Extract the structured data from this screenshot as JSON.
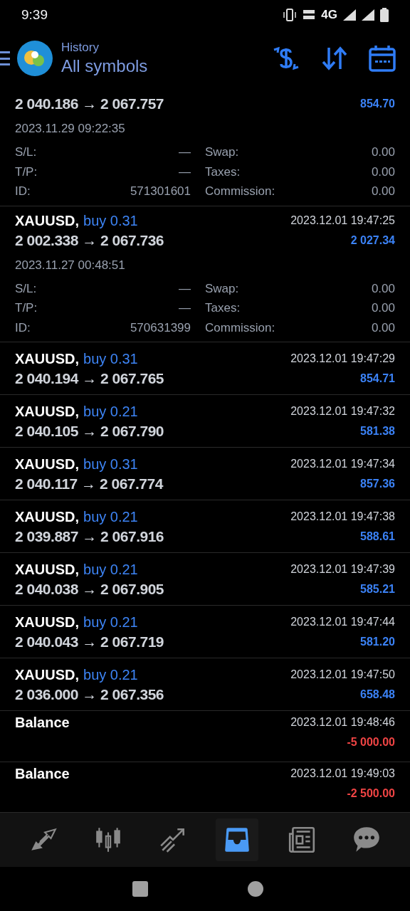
{
  "status_bar": {
    "time": "9:39",
    "network": "4G"
  },
  "header": {
    "subtitle": "History",
    "title": "All symbols"
  },
  "deals": [
    {
      "kind": "trade",
      "prices": "2 040.186 → 2 067.757",
      "profit": "854.70",
      "color": "#3b82f6",
      "open_time": "2023.11.29 09:22:35",
      "details": [
        {
          "label": "S/L:",
          "value": "—",
          "label_2": "Swap:",
          "value_2": "0.00"
        },
        {
          "label": "T/P:",
          "value": "—",
          "label_2": "Taxes:",
          "value_2": "0.00"
        },
        {
          "label": "ID:",
          "value": "571301601",
          "label_2": "Commission:",
          "value_2": "0.00"
        }
      ]
    },
    {
      "kind": "trade",
      "symbol": "XAUUSD,",
      "side": "buy 0.31",
      "time": "2023.12.01 19:47:25",
      "prices": "2 002.338 → 2 067.736",
      "profit": "2 027.34",
      "color": "#3b82f6",
      "open_time": "2023.11.27 00:48:51",
      "details": [
        {
          "label": "S/L:",
          "value": "—",
          "label_2": "Swap:",
          "value_2": "0.00"
        },
        {
          "label": "T/P:",
          "value": "—",
          "label_2": "Taxes:",
          "value_2": "0.00"
        },
        {
          "label": "ID:",
          "value": "570631399",
          "label_2": "Commission:",
          "value_2": "0.00"
        }
      ]
    },
    {
      "kind": "trade",
      "symbol": "XAUUSD,",
      "side": "buy 0.31",
      "time": "2023.12.01 19:47:29",
      "prices": "2 040.194 → 2 067.765",
      "profit": "854.71",
      "color": "#3b82f6"
    },
    {
      "kind": "trade",
      "symbol": "XAUUSD,",
      "side": "buy 0.21",
      "time": "2023.12.01 19:47:32",
      "prices": "2 040.105 → 2 067.790",
      "profit": "581.38",
      "color": "#3b82f6"
    },
    {
      "kind": "trade",
      "symbol": "XAUUSD,",
      "side": "buy 0.31",
      "time": "2023.12.01 19:47:34",
      "prices": "2 040.117 → 2 067.774",
      "profit": "857.36",
      "color": "#3b82f6"
    },
    {
      "kind": "trade",
      "symbol": "XAUUSD,",
      "side": "buy 0.21",
      "time": "2023.12.01 19:47:38",
      "prices": "2 039.887 → 2 067.916",
      "profit": "588.61",
      "color": "#3b82f6"
    },
    {
      "kind": "trade",
      "symbol": "XAUUSD,",
      "side": "buy 0.21",
      "time": "2023.12.01 19:47:39",
      "prices": "2 040.038 → 2 067.905",
      "profit": "585.21",
      "color": "#3b82f6"
    },
    {
      "kind": "trade",
      "symbol": "XAUUSD,",
      "side": "buy 0.21",
      "time": "2023.12.01 19:47:44",
      "prices": "2 040.043 → 2 067.719",
      "profit": "581.20",
      "color": "#3b82f6"
    },
    {
      "kind": "trade",
      "symbol": "XAUUSD,",
      "side": "buy 0.21",
      "time": "2023.12.01 19:47:50",
      "prices": "2 036.000 → 2 067.356",
      "profit": "658.48",
      "color": "#3b82f6"
    },
    {
      "kind": "balance",
      "symbol": "Balance",
      "time": "2023.12.01 19:48:46",
      "profit": "-5 000.00",
      "color": "#ef4444"
    },
    {
      "kind": "balance",
      "symbol": "Balance",
      "time": "2023.12.01 19:49:03",
      "profit": "-2 500.00",
      "color": "#ef4444"
    }
  ],
  "bottom_nav": [
    {
      "kind": "quotes",
      "selected": false
    },
    {
      "kind": "chart",
      "selected": false
    },
    {
      "kind": "trade",
      "selected": false
    },
    {
      "kind": "history",
      "selected": true
    },
    {
      "kind": "news",
      "selected": false
    },
    {
      "kind": "chat",
      "selected": false
    }
  ]
}
